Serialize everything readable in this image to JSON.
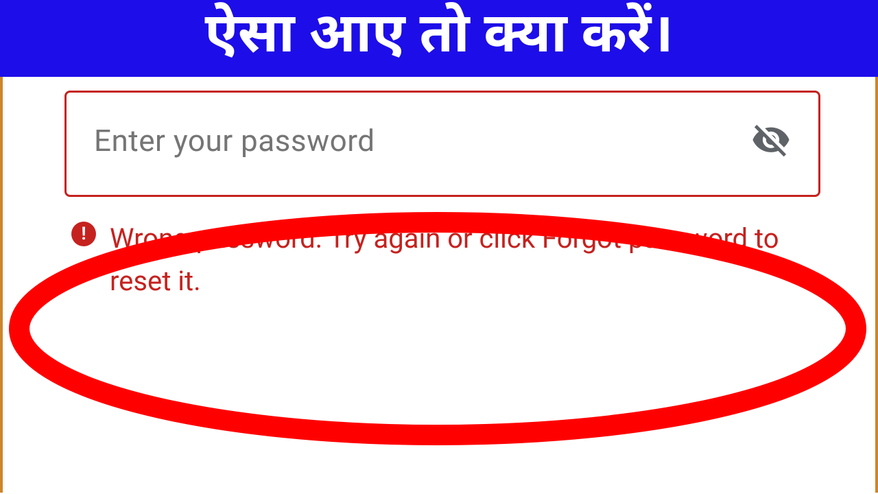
{
  "banner": {
    "text": "ऐसा आए तो क्या करें।"
  },
  "passwordField": {
    "placeholder": "Enter your password"
  },
  "error": {
    "iconSymbol": "!",
    "message": "Wrong password. Try again or click Forgot password to reset it."
  }
}
